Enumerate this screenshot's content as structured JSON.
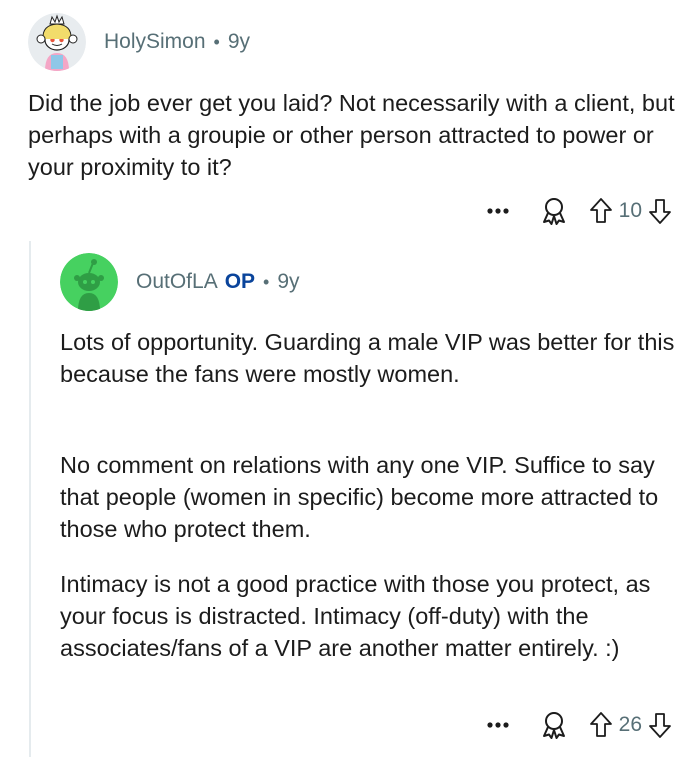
{
  "comment1": {
    "username": "HolySimon",
    "separator": "•",
    "time": "9y",
    "body": "Did the job ever get you laid?  Not necessarily with a client, but perhaps with a groupie or other person attracted to power or your proximity to it?",
    "score": "10",
    "more_icon": "ellipsis-icon",
    "award_icon": "award-icon"
  },
  "comment2": {
    "username": "OutOfLA",
    "op_badge": "OP",
    "separator": "•",
    "time": "9y",
    "paragraphs": [
      "Lots of opportunity. Guarding a male VIP was better for this because the fans were mostly women.",
      "No comment on relations with any one VIP. Suffice to say that people (women in specific) become more attracted to those who protect them.",
      "Intimacy is not a good practice with those you protect, as your focus is distracted. Intimacy (off-duty) with the associates/fans of a VIP are another matter entirely. :)"
    ],
    "score": "26"
  },
  "colors": {
    "meta_text": "#576f76",
    "op_badge": "#0a449b",
    "body_text": "#1c1c1c",
    "avatar_green": "#46d160"
  }
}
